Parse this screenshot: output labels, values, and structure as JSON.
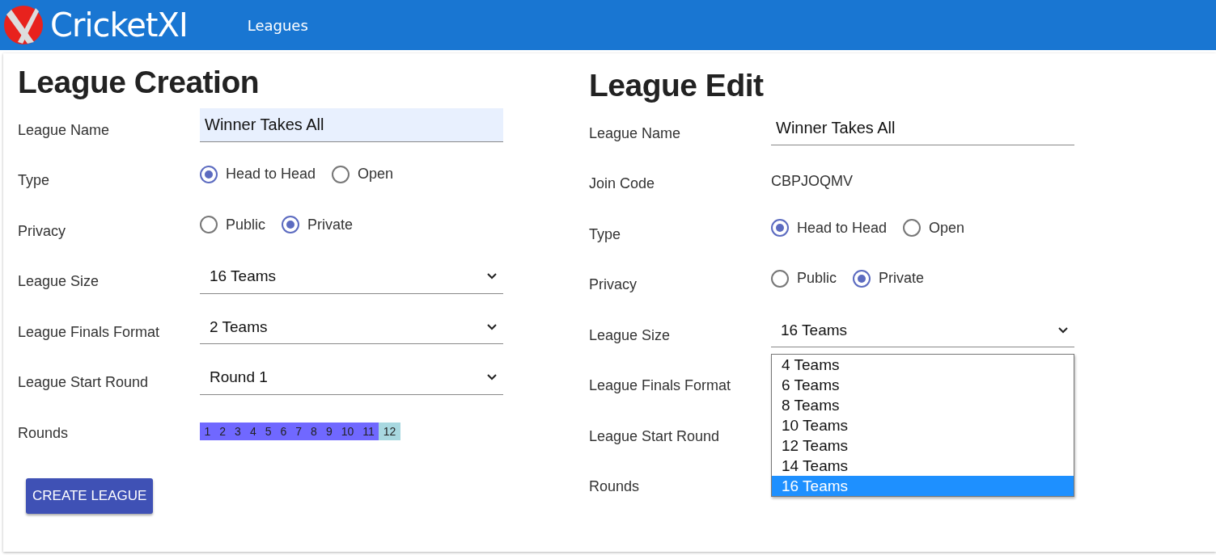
{
  "header": {
    "brand": "CricketXI",
    "nav": [
      {
        "label": "Leagues"
      }
    ]
  },
  "forms": [
    {
      "title": "League Creation",
      "rows": [
        {
          "kind": "text",
          "label": "League Name",
          "value": "Winner Takes All",
          "focused": true
        },
        {
          "kind": "radio",
          "label": "Type",
          "options": [
            {
              "label": "Head to Head",
              "selected": true
            },
            {
              "label": "Open",
              "selected": false
            }
          ]
        },
        {
          "kind": "radio",
          "label": "Privacy",
          "options": [
            {
              "label": "Public",
              "selected": false
            },
            {
              "label": "Private",
              "selected": true
            }
          ]
        },
        {
          "kind": "select",
          "label": "League Size",
          "value": "16 Teams"
        },
        {
          "kind": "select",
          "label": "League Finals Format",
          "value": "2 Teams"
        },
        {
          "kind": "select",
          "label": "League Start Round",
          "value": "Round 1"
        },
        {
          "kind": "rounds",
          "label": "Rounds",
          "rounds": [
            {
              "label": "1",
              "selected": true
            },
            {
              "label": "2",
              "selected": true
            },
            {
              "label": "3",
              "selected": true
            },
            {
              "label": "4",
              "selected": true
            },
            {
              "label": "5",
              "selected": true
            },
            {
              "label": "6",
              "selected": true
            },
            {
              "label": "7",
              "selected": true
            },
            {
              "label": "8",
              "selected": true
            },
            {
              "label": "9",
              "selected": true
            },
            {
              "label": "10",
              "selected": true
            },
            {
              "label": "11",
              "selected": true
            },
            {
              "label": "12",
              "selected": false
            }
          ]
        }
      ],
      "button": "CREATE LEAGUE"
    },
    {
      "title": "League Edit",
      "rows": [
        {
          "kind": "text",
          "label": "League Name",
          "value": "Winner Takes All",
          "focused": false
        },
        {
          "kind": "static",
          "label": "Join Code",
          "value": "CBPJOQMV"
        },
        {
          "kind": "radio",
          "label": "Type",
          "options": [
            {
              "label": "Head to Head",
              "selected": true
            },
            {
              "label": "Open",
              "selected": false
            }
          ]
        },
        {
          "kind": "radio",
          "label": "Privacy",
          "options": [
            {
              "label": "Public",
              "selected": false
            },
            {
              "label": "Private",
              "selected": true
            }
          ]
        },
        {
          "kind": "select",
          "label": "League Size",
          "value": "16 Teams",
          "open": true,
          "options": [
            {
              "label": "4 Teams",
              "selected": false
            },
            {
              "label": "6 Teams",
              "selected": false
            },
            {
              "label": "8 Teams",
              "selected": false
            },
            {
              "label": "10 Teams",
              "selected": false
            },
            {
              "label": "12 Teams",
              "selected": false
            },
            {
              "label": "14 Teams",
              "selected": false
            },
            {
              "label": "16 Teams",
              "selected": true
            }
          ]
        },
        {
          "kind": "covered",
          "label": "League Finals Format"
        },
        {
          "kind": "covered",
          "label": "League Start Round"
        },
        {
          "kind": "covered",
          "label": "Rounds"
        }
      ]
    }
  ]
}
